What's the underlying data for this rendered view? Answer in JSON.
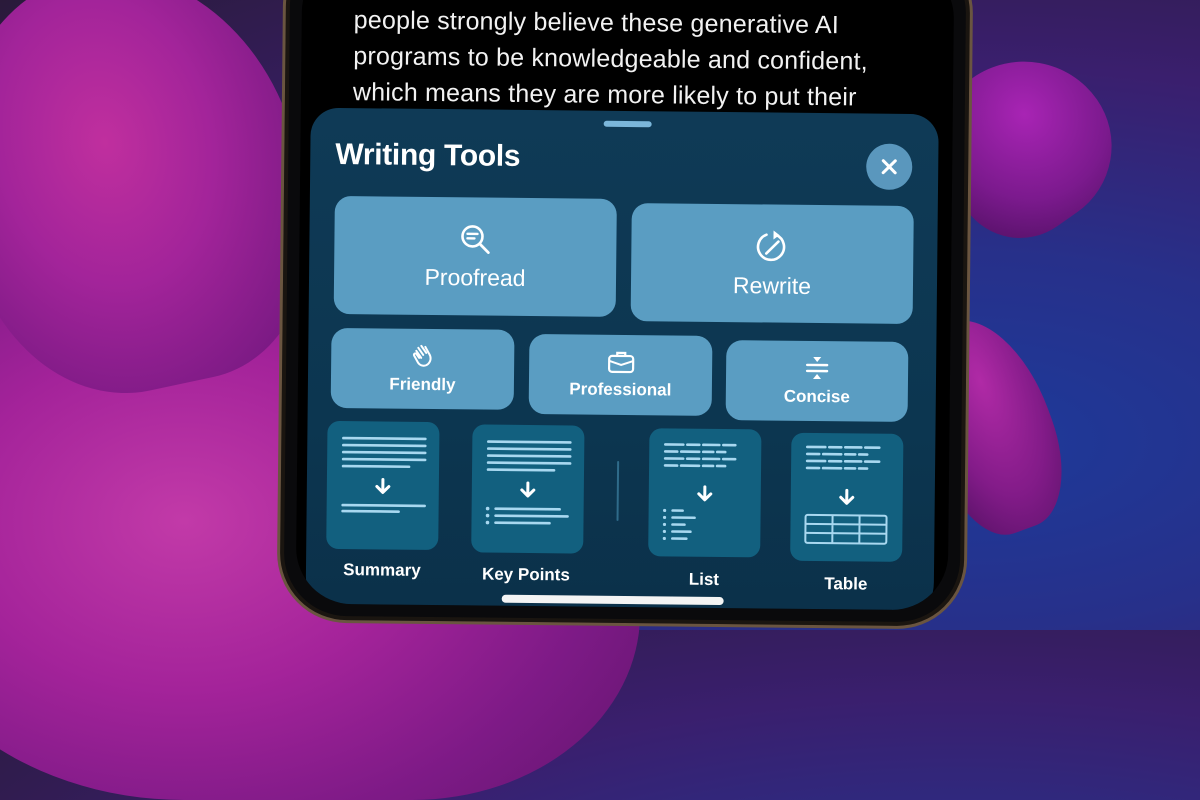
{
  "document": {
    "lines": [
      "people strongly believe these generative AI",
      "programs to be knowledgeable and confident,",
      "which means they are more likely to put their"
    ]
  },
  "writing_tools": {
    "title": "Writing Tools",
    "close_icon": "close-icon",
    "primary_actions": [
      {
        "label": "Proofread",
        "icon": "magnifier-text-icon"
      },
      {
        "label": "Rewrite",
        "icon": "rewrite-circle-pencil-icon"
      }
    ],
    "tone_actions": [
      {
        "label": "Friendly",
        "icon": "waving-hand-icon"
      },
      {
        "label": "Professional",
        "icon": "briefcase-icon"
      },
      {
        "label": "Concise",
        "icon": "compress-icon"
      }
    ],
    "format_actions": [
      {
        "label": "Summary",
        "icon": "summary-icon"
      },
      {
        "label": "Key Points",
        "icon": "key-points-icon"
      },
      {
        "label": "List",
        "icon": "list-icon"
      },
      {
        "label": "Table",
        "icon": "table-icon"
      }
    ]
  },
  "colors": {
    "sheet_bg": "#0f3a56",
    "button_bg": "#5a9dc2",
    "card_bg": "#12607f",
    "icon_line": "#a8d8f0",
    "close_bg": "#5a97bd"
  }
}
